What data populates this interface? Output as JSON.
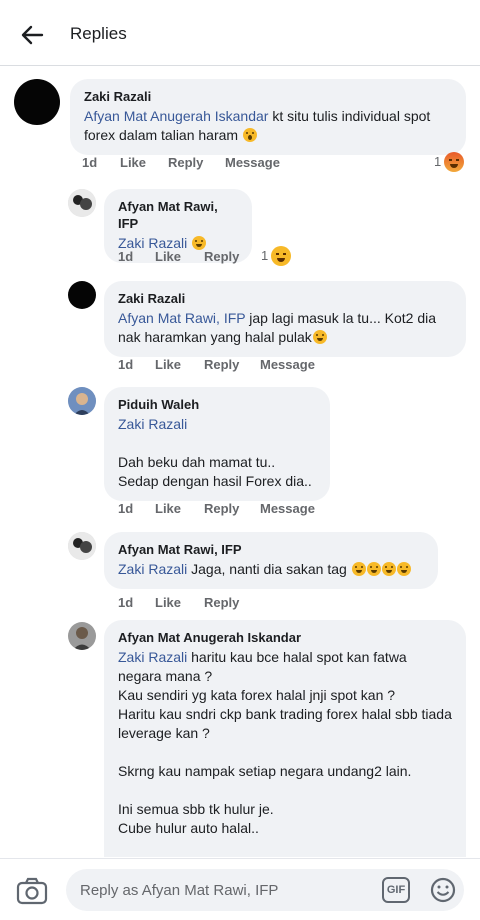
{
  "header": {
    "title": "Replies"
  },
  "comments": [
    {
      "name": "Zaki Razali",
      "mention": "Afyan Mat Anugerah Iskandar",
      "text": " kt situ tulis individual spot forex dalam talian haram",
      "time": "1d",
      "like": "Like",
      "reply": "Reply",
      "message": "Message",
      "reaction_count": "1",
      "reaction": "angry"
    },
    {
      "name": "Afyan Mat Rawi, IFP",
      "mention": "Zaki Razali",
      "text": "",
      "time": "1d",
      "like": "Like",
      "reply": "Reply",
      "reaction_count": "1",
      "reaction": "haha"
    },
    {
      "name": "Zaki Razali",
      "mention": "Afyan Mat Rawi, IFP",
      "text": " jap lagi masuk la tu... Kot2 dia nak haramkan yang halal pulak",
      "time": "1d",
      "like": "Like",
      "reply": "Reply",
      "message": "Message"
    },
    {
      "name": "Piduih Waleh",
      "mention": "Zaki Razali",
      "text": "Dah beku dah mamat tu..\nSedap dengan hasil Forex dia..",
      "time": "1d",
      "like": "Like",
      "reply": "Reply",
      "message": "Message"
    },
    {
      "name": "Afyan Mat Rawi, IFP",
      "mention": "Zaki Razali",
      "text": " Jaga, nanti dia sakan tag ",
      "time": "1d",
      "like": "Like",
      "reply": "Reply"
    },
    {
      "name": "Afyan Mat Anugerah Iskandar",
      "mention": "Zaki Razali",
      "text": " haritu kau bce halal spot kan fatwa negara mana ?\nKau sendiri yg kata forex halal jnji spot kan ?\nHaritu kau sndri ckp bank trading forex halal sbb tiada leverage kan ?\n\nSkrng kau nampak setiap negara undang2 lain.\n\nIni semua sbb tk hulur je.\nCube hulur auto halal..\n\nDkt indonesia tahu crypto dah kne banned ?"
    }
  ],
  "composer": {
    "placeholder": "Reply as Afyan Mat Rawi, IFP",
    "gif_label": "GIF"
  },
  "icons": [
    "back-arrow-icon",
    "camera-icon",
    "gif-icon",
    "emoji-icon"
  ],
  "colors": {
    "mention": "#385898",
    "bubble": "#f0f2f5",
    "meta": "#65676b"
  }
}
